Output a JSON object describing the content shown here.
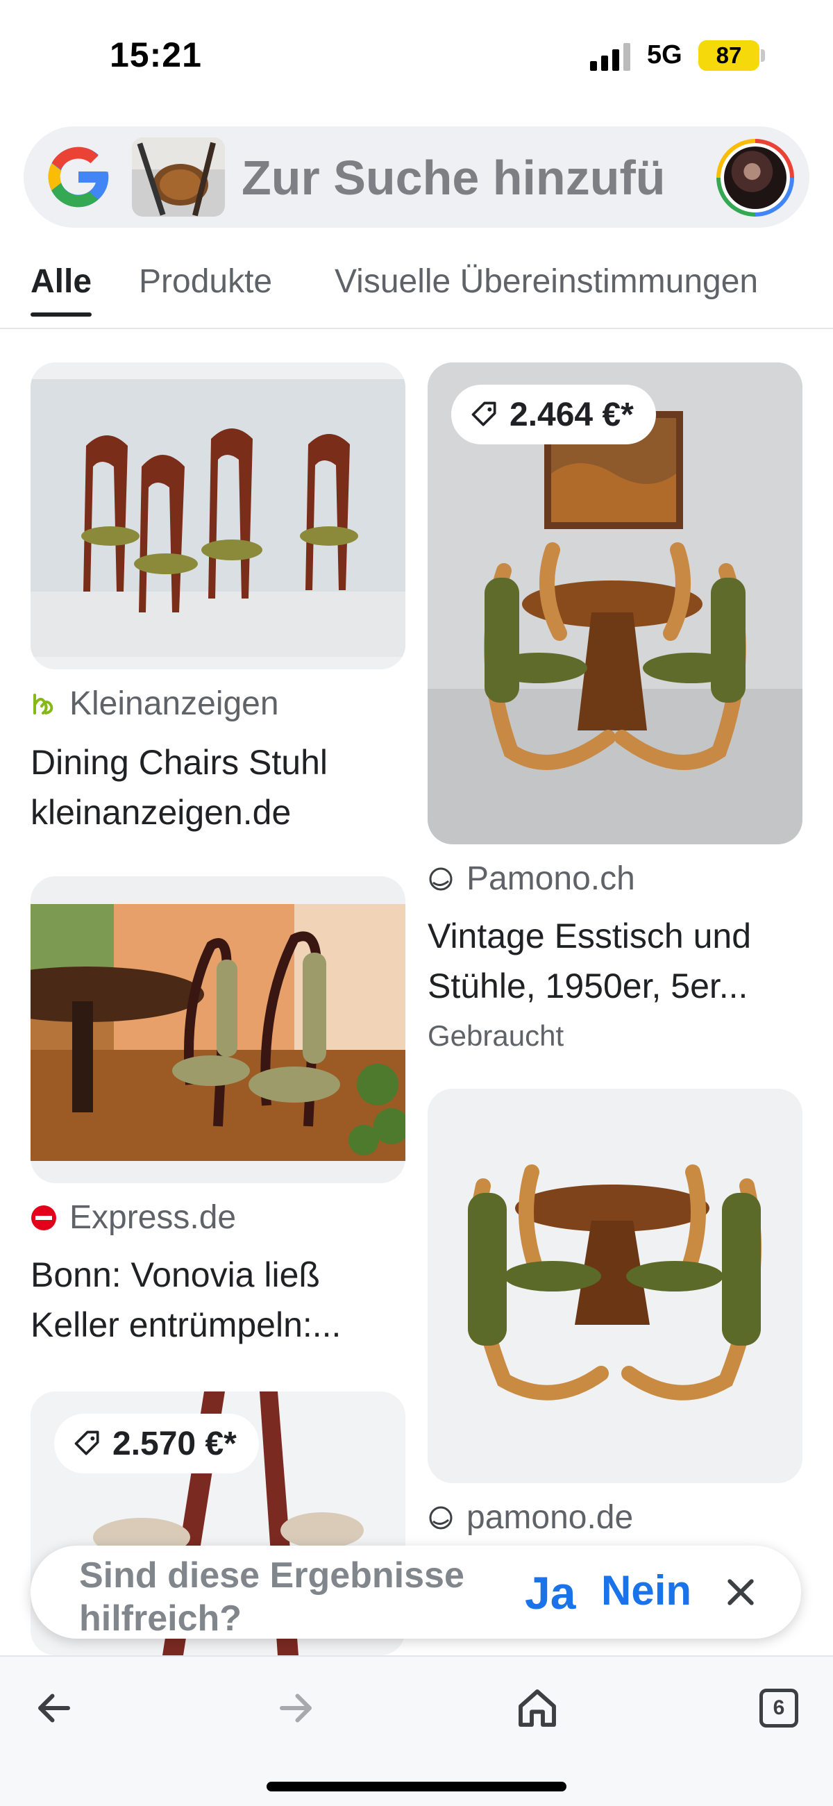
{
  "status_bar": {
    "time": "15:21",
    "network": "5G",
    "battery": "87"
  },
  "search": {
    "query_text": "Zur Suche hinzufü"
  },
  "tabs": [
    {
      "label": "Alle",
      "active": true
    },
    {
      "label": "Produkte",
      "active": false
    },
    {
      "label": "Visuelle Übereinstimmungen",
      "active": false
    }
  ],
  "results": {
    "r1": {
      "source": "Kleinanzeigen",
      "title": "Dining Chairs Stuhl kleinanzeigen.de"
    },
    "r2": {
      "price": "2.464 €*",
      "source": "Pamono.ch",
      "title": "Vintage Esstisch und Stühle, 1950er, 5er...",
      "condition": "Gebraucht"
    },
    "r3": {
      "source": "Express.de",
      "title": "Bonn: Vonovia ließ Keller entrümpeln:..."
    },
    "r4": {
      "source": "pamono.de"
    },
    "r5": {
      "price": "2.570 €*"
    }
  },
  "feedback": {
    "question": "Sind diese Ergebnisse hilfreich?",
    "yes_label": "Ja",
    "no_label": "Nein"
  },
  "toolbar": {
    "tab_count": "6"
  },
  "colors": {
    "accent_blue": "#1a73e8",
    "battery_yellow": "#f5d90a",
    "express_red": "#e3001b",
    "kleinanzeigen_green": "#86b817"
  }
}
